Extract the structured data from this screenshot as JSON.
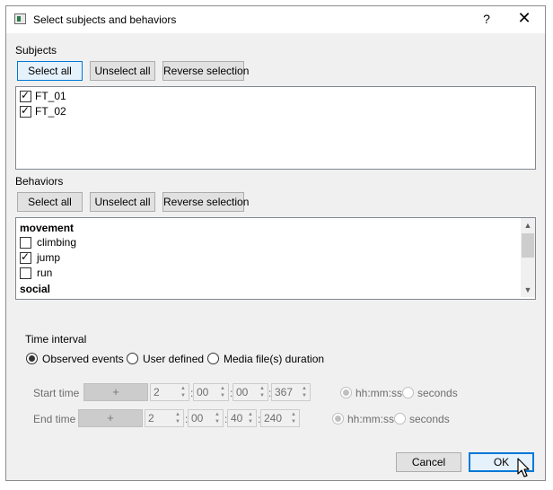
{
  "window": {
    "title": "Select subjects and behaviors",
    "help_label": "?",
    "close_label": "✕"
  },
  "subjects": {
    "heading": "Subjects",
    "select_all": "Select all",
    "unselect_all": "Unselect all",
    "reverse": "Reverse selection",
    "items": [
      {
        "label": "FT_01",
        "checked": true
      },
      {
        "label": "FT_02",
        "checked": true
      }
    ]
  },
  "behaviors": {
    "heading": "Behaviors",
    "select_all": "Select all",
    "unselect_all": "Unselect all",
    "reverse": "Reverse selection",
    "groups": [
      {
        "name": "movement",
        "items": [
          {
            "label": "climbing",
            "checked": false
          },
          {
            "label": "jump",
            "checked": true
          },
          {
            "label": "run",
            "checked": false
          }
        ]
      },
      {
        "name": "social",
        "items": []
      }
    ]
  },
  "time_interval": {
    "heading": "Time interval",
    "options": [
      "Observed events",
      "User defined",
      "Media file(s) duration"
    ],
    "selected": "Observed events",
    "start": {
      "label": "Start time",
      "plus": "+",
      "h": "2",
      "m": "00",
      "s": "00",
      "ms": "367",
      "fmt_hms": "hh:mm:ss",
      "fmt_sec": "seconds"
    },
    "end": {
      "label": "End time",
      "plus": "+",
      "h": "2",
      "m": "00",
      "s": "40",
      "ms": "240",
      "fmt_hms": "hh:mm:ss",
      "fmt_sec": "seconds"
    }
  },
  "footer": {
    "cancel": "Cancel",
    "ok": "OK"
  }
}
